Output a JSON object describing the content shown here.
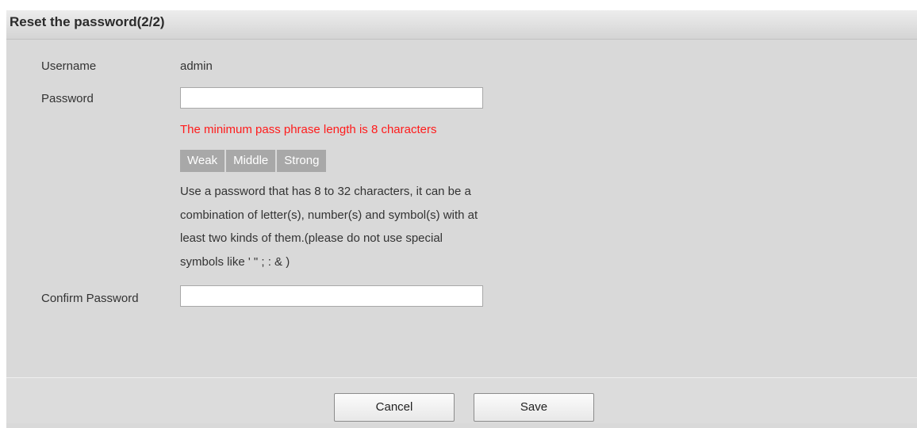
{
  "dialog": {
    "title": "Reset the password(2/2)"
  },
  "form": {
    "username_label": "Username",
    "username_value": "admin",
    "password_label": "Password",
    "password_value": "",
    "error_message": "The minimum pass phrase length is 8 characters",
    "strength": {
      "weak": "Weak",
      "middle": "Middle",
      "strong": "Strong"
    },
    "hint": "Use a password that has 8 to 32 characters, it can be a combination of letter(s), number(s) and symbol(s) with at least two kinds of them.(please do not use special symbols like ' \" ; : & )",
    "confirm_label": "Confirm Password",
    "confirm_value": ""
  },
  "buttons": {
    "cancel": "Cancel",
    "save": "Save"
  },
  "colors": {
    "panel_bg": "#d9d9d9",
    "error": "#ff1b1b",
    "strength_inactive": "#a8a8a8"
  }
}
